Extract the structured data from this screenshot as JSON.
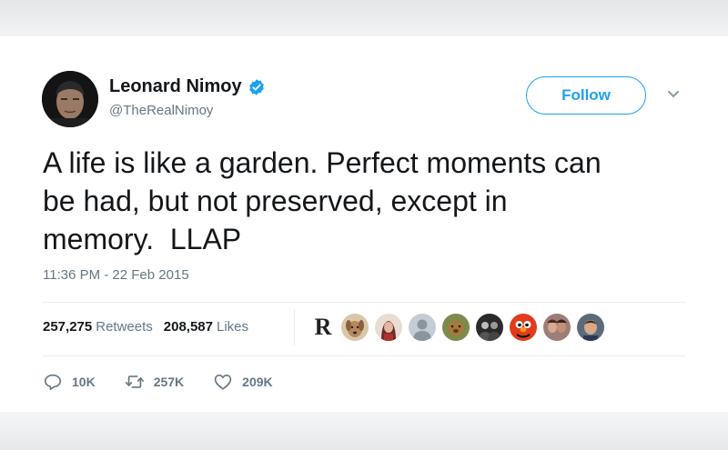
{
  "user": {
    "name": "Leonard Nimoy",
    "handle": "@TheRealNimoy"
  },
  "follow_label": "Follow",
  "tweet": {
    "lines": [
      "A life is like a garden. Perfect moments can",
      "be had, but not preserved, except in",
      "memory.  LLAP"
    ],
    "timestamp": "11:36 PM - 22 Feb 2015"
  },
  "stats": {
    "retweets_count": "257,275",
    "retweets_label": "Retweets",
    "likes_count": "208,587",
    "likes_label": "Likes"
  },
  "likers": {
    "first_initial": "R"
  },
  "actions": {
    "reply_count": "10K",
    "retweet_count": "257K",
    "like_count": "209K"
  },
  "colors": {
    "accent": "#1da1f2",
    "text_primary": "#14171a",
    "text_secondary": "#657786",
    "divider": "#e6ecf0"
  },
  "icons": {
    "verified": "verified-badge-icon",
    "caret": "chevron-down-icon",
    "reply": "reply-icon",
    "retweet": "retweet-icon",
    "like": "heart-icon"
  }
}
